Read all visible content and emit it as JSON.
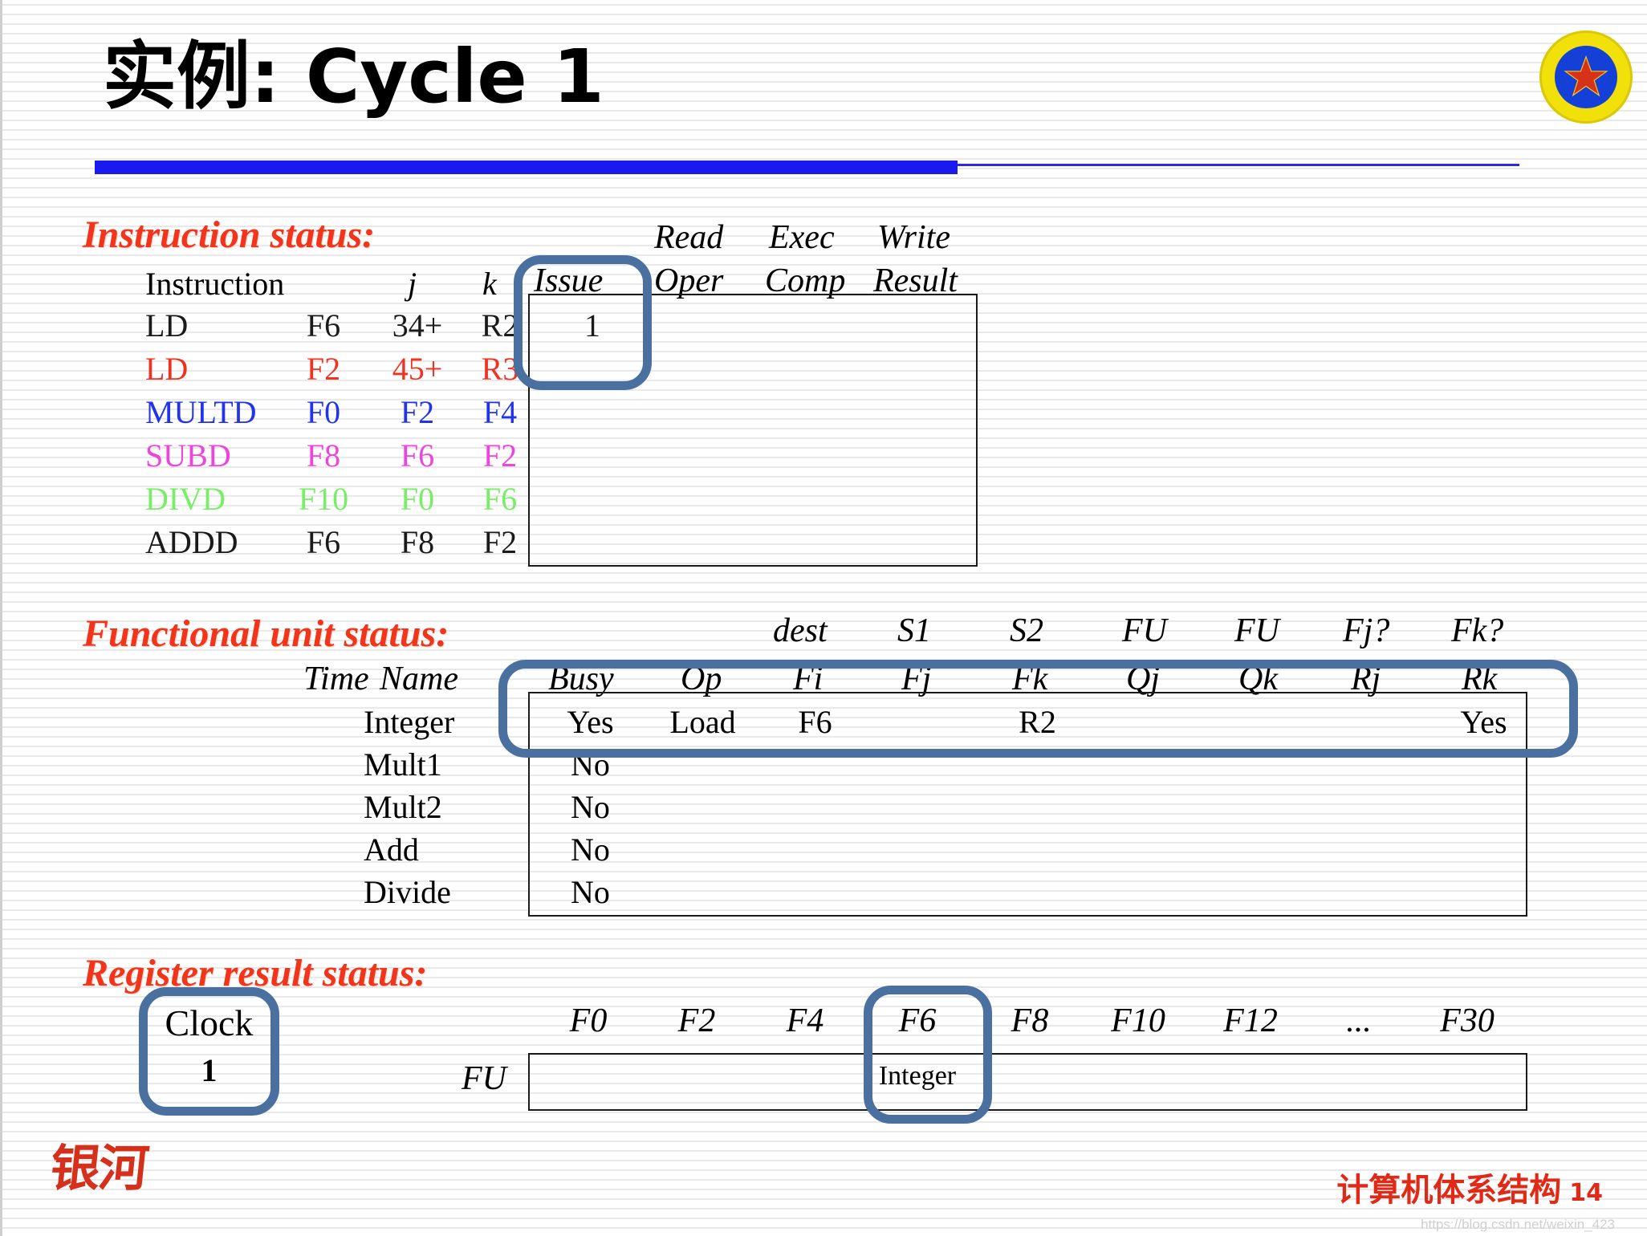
{
  "slide": {
    "title": "实例: Cycle 1",
    "page_number": "14",
    "footer_text": "计算机体系结构",
    "brandmark": "银河",
    "watermark": "https://blog.csdn.net/weixin_423",
    "accent_blue": "#1a1af0",
    "annotation_blue": "#4a709f",
    "heading_red": "#f2341a"
  },
  "instruction_status": {
    "heading": "Instruction status:",
    "group_headers": [
      "Read",
      "Exec",
      "Write"
    ],
    "columns": [
      "Instruction",
      "",
      "j",
      "k",
      "Issue",
      "Oper",
      "Comp",
      "Result"
    ],
    "rows": [
      {
        "op": "LD",
        "dest": "F6",
        "j": "34+",
        "k": "R2",
        "issue": "1",
        "oper": "",
        "comp": "",
        "result": "",
        "color": "c-black"
      },
      {
        "op": "LD",
        "dest": "F2",
        "j": "45+",
        "k": "R3",
        "issue": "",
        "oper": "",
        "comp": "",
        "result": "",
        "color": "c-red"
      },
      {
        "op": "MULTD",
        "dest": "F0",
        "j": "F2",
        "k": "F4",
        "issue": "",
        "oper": "",
        "comp": "",
        "result": "",
        "color": "c-blue"
      },
      {
        "op": "SUBD",
        "dest": "F8",
        "j": "F6",
        "k": "F2",
        "issue": "",
        "oper": "",
        "comp": "",
        "result": "",
        "color": "c-magenta"
      },
      {
        "op": "DIVD",
        "dest": "F10",
        "j": "F0",
        "k": "F6",
        "issue": "",
        "oper": "",
        "comp": "",
        "result": "",
        "color": "c-green"
      },
      {
        "op": "ADDD",
        "dest": "F6",
        "j": "F8",
        "k": "F2",
        "issue": "",
        "oper": "",
        "comp": "",
        "result": "",
        "color": "c-black"
      }
    ]
  },
  "functional_unit_status": {
    "heading": "Functional unit status:",
    "group_headers": [
      "dest",
      "S1",
      "S2",
      "FU",
      "FU",
      "Fj?",
      "Fk?"
    ],
    "columns": [
      "Time",
      "Name",
      "Busy",
      "Op",
      "Fi",
      "Fj",
      "Fk",
      "Qj",
      "Qk",
      "Rj",
      "Rk"
    ],
    "rows": [
      {
        "time": "",
        "name": "Integer",
        "busy": "Yes",
        "op": "Load",
        "fi": "F6",
        "fj": "",
        "fk": "R2",
        "qj": "",
        "qk": "",
        "rj": "",
        "rk": "Yes"
      },
      {
        "time": "",
        "name": "Mult1",
        "busy": "No",
        "op": "",
        "fi": "",
        "fj": "",
        "fk": "",
        "qj": "",
        "qk": "",
        "rj": "",
        "rk": ""
      },
      {
        "time": "",
        "name": "Mult2",
        "busy": "No",
        "op": "",
        "fi": "",
        "fj": "",
        "fk": "",
        "qj": "",
        "qk": "",
        "rj": "",
        "rk": ""
      },
      {
        "time": "",
        "name": "Add",
        "busy": "No",
        "op": "",
        "fi": "",
        "fj": "",
        "fk": "",
        "qj": "",
        "qk": "",
        "rj": "",
        "rk": ""
      },
      {
        "time": "",
        "name": "Divide",
        "busy": "No",
        "op": "",
        "fi": "",
        "fj": "",
        "fk": "",
        "qj": "",
        "qk": "",
        "rj": "",
        "rk": ""
      }
    ]
  },
  "register_result_status": {
    "heading": "Register result status:",
    "clock_label": "Clock",
    "clock_value": "1",
    "row_label": "FU",
    "registers": [
      "F0",
      "F2",
      "F4",
      "F6",
      "F8",
      "F10",
      "F12",
      "...",
      "F30"
    ],
    "values": [
      "",
      "",
      "",
      "Integer",
      "",
      "",
      "",
      "",
      ""
    ]
  }
}
